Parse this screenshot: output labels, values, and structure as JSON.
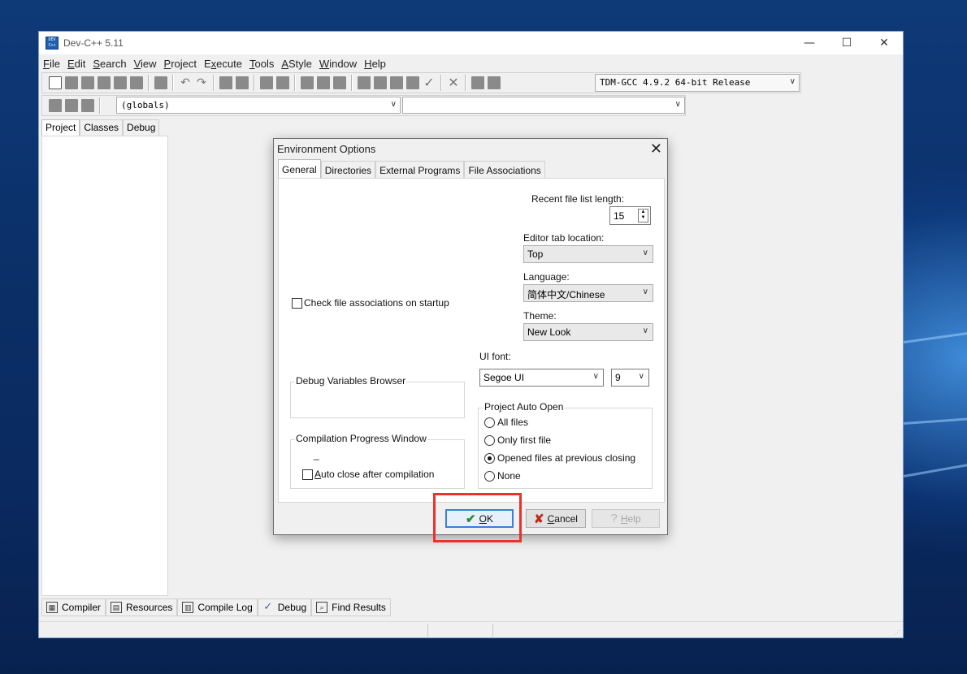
{
  "window": {
    "title": "Dev-C++ 5.11",
    "logo_text": "DEV C++",
    "controls": {
      "minimize": "—",
      "maximize": "☐",
      "close": "✕"
    }
  },
  "menu": [
    {
      "label": "File",
      "u": "F",
      "rest": "ile"
    },
    {
      "label": "Edit",
      "u": "E",
      "rest": "dit"
    },
    {
      "label": "Search",
      "u": "S",
      "rest": "earch"
    },
    {
      "label": "View",
      "u": "V",
      "rest": "iew"
    },
    {
      "label": "Project",
      "u": "P",
      "rest": "roject"
    },
    {
      "label": "Execute",
      "pre": "E",
      "u": "x",
      "rest": "ecute"
    },
    {
      "label": "Tools",
      "u": "T",
      "rest": "ools"
    },
    {
      "label": "AStyle",
      "u": "A",
      "rest": "Style"
    },
    {
      "label": "Window",
      "u": "W",
      "rest": "indow"
    },
    {
      "label": "Help",
      "u": "H",
      "rest": "elp"
    }
  ],
  "toolbar": {
    "compiler_select": "TDM-GCC 4.9.2 64-bit Release",
    "globals_select": "(globals)",
    "second_select": ""
  },
  "left_tabs": [
    "Project",
    "Classes",
    "Debug"
  ],
  "bottom_tabs": [
    {
      "label": "Compiler",
      "icon": "compiler-icon",
      "glyph": "▦"
    },
    {
      "label": "Resources",
      "icon": "resources-icon",
      "glyph": "▤"
    },
    {
      "label": "Compile Log",
      "icon": "compile-log-icon",
      "glyph": "▥"
    },
    {
      "label": "Debug",
      "icon": "debug-check-icon",
      "glyph": "✓"
    },
    {
      "label": "Find Results",
      "icon": "find-results-icon",
      "glyph": "⌕"
    }
  ],
  "dialog": {
    "title": "Environment Options",
    "tabs": [
      "General",
      "Directories",
      "External Programs",
      "File Associations"
    ],
    "recent_files_label": "Recent file list length:",
    "recent_files_value": "15",
    "editor_tab_label": "Editor tab location:",
    "editor_tab_value": "Top",
    "language_label": "Language:",
    "language_value": "简体中文/Chinese",
    "theme_label": "Theme:",
    "theme_value": "New Look",
    "ui_font_label": "UI font:",
    "ui_font_value": "Segoe UI",
    "ui_font_size": "9",
    "check_assoc_label": "Check file associations on startup",
    "debug_vars_group": "Debug Variables Browser",
    "compile_progress_group": "Compilation Progress Window",
    "compile_progress_mark": "_",
    "auto_close_label": "Auto close after compilation",
    "auto_close_u": "A",
    "auto_close_rest": "uto close after compilation",
    "project_auto_open_group": "Project Auto Open",
    "radio_options": [
      "All files",
      "Only first file",
      "Opened files at previous closing",
      "None"
    ],
    "radio_selected": 2,
    "buttons": {
      "ok": {
        "u": "O",
        "rest": "K"
      },
      "cancel": {
        "u": "C",
        "rest": "ancel"
      },
      "help": {
        "u": "H",
        "rest": "elp"
      }
    }
  },
  "colors": {
    "highlight": "#e8322a",
    "ok_icon": "#2e8b2e",
    "cancel_icon": "#c0281c"
  }
}
